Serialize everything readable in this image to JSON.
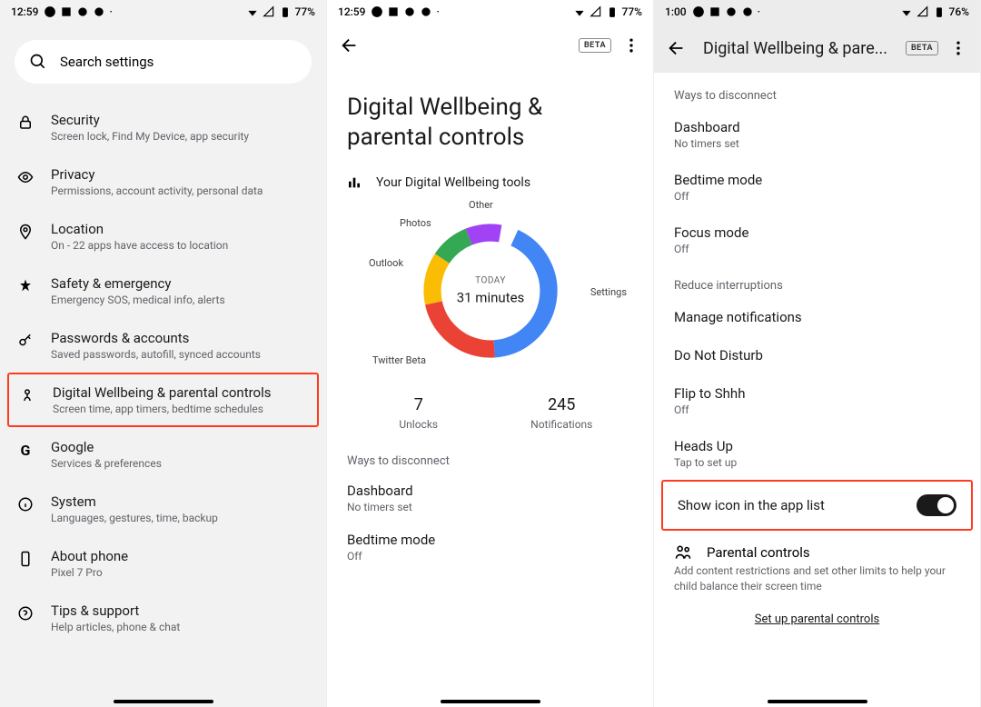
{
  "panel1": {
    "status": {
      "time": "12:59",
      "battery": "77%"
    },
    "search_label": "Search settings",
    "items": [
      {
        "title": "Security",
        "sub": "Screen lock, Find My Device, app security"
      },
      {
        "title": "Privacy",
        "sub": "Permissions, account activity, personal data"
      },
      {
        "title": "Location",
        "sub": "On - 22 apps have access to location"
      },
      {
        "title": "Safety & emergency",
        "sub": "Emergency SOS, medical info, alerts"
      },
      {
        "title": "Passwords & accounts",
        "sub": "Saved passwords, autofill, synced accounts"
      },
      {
        "title": "Digital Wellbeing & parental controls",
        "sub": "Screen time, app timers, bedtime schedules"
      },
      {
        "title": "Google",
        "sub": "Services & preferences"
      },
      {
        "title": "System",
        "sub": "Languages, gestures, time, backup"
      },
      {
        "title": "About phone",
        "sub": "Pixel 7 Pro"
      },
      {
        "title": "Tips & support",
        "sub": "Help articles, phone & chat"
      }
    ]
  },
  "panel2": {
    "status": {
      "time": "12:59",
      "battery": "77%"
    },
    "beta": "BETA",
    "title": "Digital Wellbeing & parental controls",
    "tools_header": "Your Digital Wellbeing tools",
    "chart_center": {
      "today": "TODAY",
      "minutes": "31 minutes"
    },
    "chart_labels": {
      "settings": "Settings",
      "twitter": "Twitter Beta",
      "outlook": "Outlook",
      "photos": "Photos",
      "other": "Other"
    },
    "stats": {
      "unlocks": "7",
      "unlocks_label": "Unlocks",
      "notifs": "245",
      "notifs_label": "Notifications"
    },
    "section_disconnect": "Ways to disconnect",
    "dashboard": {
      "t": "Dashboard",
      "s": "No timers set"
    },
    "bedtime": {
      "t": "Bedtime mode",
      "s": "Off"
    }
  },
  "panel3": {
    "status": {
      "time": "1:00",
      "battery": "76%"
    },
    "beta": "BETA",
    "title": "Digital Wellbeing & pare...",
    "section_disconnect": "Ways to disconnect",
    "dashboard": {
      "t": "Dashboard",
      "s": "No timers set"
    },
    "bedtime": {
      "t": "Bedtime mode",
      "s": "Off"
    },
    "focus": {
      "t": "Focus mode",
      "s": "Off"
    },
    "section_reduce": "Reduce interruptions",
    "manage_notifs": "Manage notifications",
    "dnd": "Do Not Disturb",
    "flip": {
      "t": "Flip to Shhh",
      "s": "Off"
    },
    "headsup": {
      "t": "Heads Up",
      "s": "Tap to set up"
    },
    "show_icon": "Show icon in the app list",
    "parental_title": "Parental controls",
    "parental_sub": "Add content restrictions and set other limits to help your child balance their screen time",
    "setup_link": "Set up parental controls"
  },
  "chart_data": {
    "type": "pie",
    "title": "Your Digital Wellbeing tools",
    "center_label": "TODAY",
    "center_value": "31 minutes",
    "categories": [
      "Settings",
      "Twitter Beta",
      "Outlook",
      "Photos",
      "Other"
    ],
    "values": [
      13,
      7,
      4,
      3,
      4
    ],
    "colors": [
      "#4285f4",
      "#ea4335",
      "#fbbc04",
      "#34a853",
      "#a142f4"
    ]
  }
}
